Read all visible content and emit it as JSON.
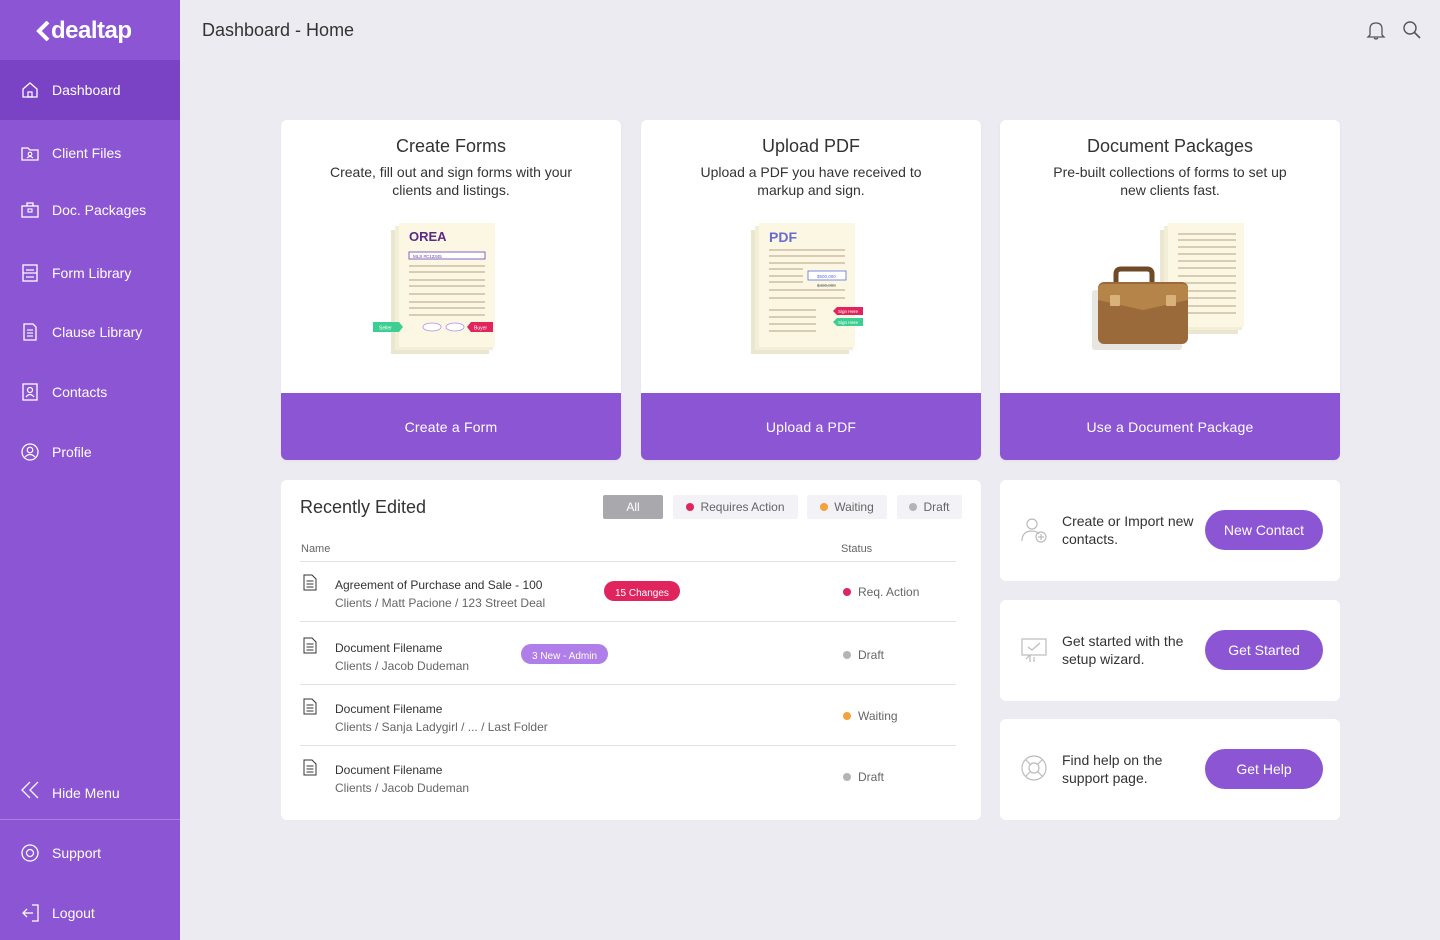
{
  "sidebar": {
    "logo": "dealtap",
    "items": [
      {
        "label": "Dashboard",
        "icon": "home-icon"
      },
      {
        "label": "Client Files",
        "icon": "client-files-icon"
      },
      {
        "label": "Doc. Packages",
        "icon": "briefcase-icon"
      },
      {
        "label": "Form Library",
        "icon": "form-library-icon"
      },
      {
        "label": "Clause Library",
        "icon": "clause-library-icon"
      },
      {
        "label": "Contacts",
        "icon": "contacts-icon"
      },
      {
        "label": "Profile",
        "icon": "profile-icon"
      }
    ],
    "hide_menu": "Hide Menu",
    "support": "Support",
    "logout": "Logout"
  },
  "header": {
    "title": "Dashboard - Home",
    "icons": [
      "bell-icon",
      "search-icon"
    ]
  },
  "cards": [
    {
      "title": "Create Forms",
      "description": "Create, fill out and sign forms with your clients and listings.",
      "button": "Create a Form",
      "illustration": {
        "brand": "OREA",
        "field": "MLS #C12345",
        "tag_left": "Seller",
        "tag_right": "Buyer"
      }
    },
    {
      "title": "Upload PDF",
      "description": "Upload a PDF you have received to markup and sign.",
      "button": "Upload a PDF",
      "illustration": {
        "brand": "PDF",
        "value_new": "$500,000",
        "value_old": "$400,000",
        "sign_1": "Sign Here",
        "sign_2": "Sign Here"
      }
    },
    {
      "title": "Document Packages",
      "description": "Pre-built collections of forms to set up new clients fast.",
      "button": "Use a Document Package"
    }
  ],
  "recent": {
    "title": "Recently Edited",
    "filters": [
      {
        "label": "All",
        "active": true
      },
      {
        "label": "Requires Action",
        "color": "#e0245e"
      },
      {
        "label": "Waiting",
        "color": "#f5a13c"
      },
      {
        "label": "Draft",
        "color": "#b3b3b8"
      }
    ],
    "columns": {
      "name": "Name",
      "status": "Status"
    },
    "rows": [
      {
        "name": "Agreement of Purchase and Sale - 100",
        "path": "Clients / Matt Pacione / 123 Street Deal",
        "badge": "15 Changes",
        "badge_color": "#e0245e",
        "status": "Req. Action",
        "status_color": "#e0245e"
      },
      {
        "name": "Document Filename",
        "path": "Clients / Jacob Dudeman",
        "badge": "3 New - Admin",
        "badge_color": "#b07ee8",
        "status": "Draft",
        "status_color": "#b3b3b8"
      },
      {
        "name": "Document Filename",
        "path": "Clients / Sanja Ladygirl / ... / Last Folder",
        "status": "Waiting",
        "status_color": "#f5a13c"
      },
      {
        "name": "Document Filename",
        "path": "Clients / Jacob Dudeman",
        "status": "Draft",
        "status_color": "#b3b3b8"
      }
    ]
  },
  "quick": [
    {
      "text": "Create or Import new contacts.",
      "button": "New Contact",
      "icon": "add-contact-icon"
    },
    {
      "text": "Get started with the setup wizard.",
      "button": "Get Started",
      "icon": "setup-wizard-icon"
    },
    {
      "text": "Find help on the support page.",
      "button": "Get Help",
      "icon": "lifebuoy-icon"
    }
  ],
  "colors": {
    "accent": "#8c55d4",
    "accent_dark": "#7a42c4",
    "background": "#edebf2"
  }
}
